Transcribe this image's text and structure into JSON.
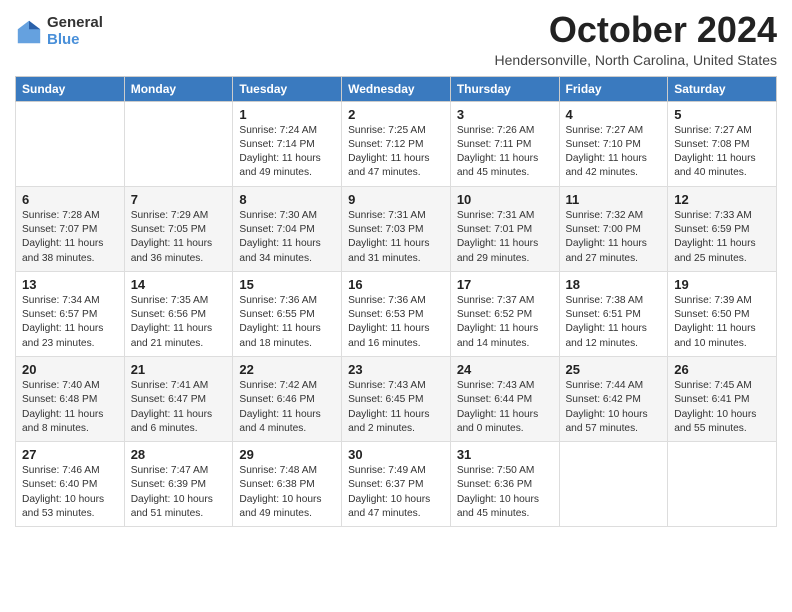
{
  "header": {
    "logo_general": "General",
    "logo_blue": "Blue",
    "month_title": "October 2024",
    "location": "Hendersonville, North Carolina, United States"
  },
  "days_of_week": [
    "Sunday",
    "Monday",
    "Tuesday",
    "Wednesday",
    "Thursday",
    "Friday",
    "Saturday"
  ],
  "weeks": [
    [
      {
        "day": "",
        "sunrise": "",
        "sunset": "",
        "daylight": ""
      },
      {
        "day": "",
        "sunrise": "",
        "sunset": "",
        "daylight": ""
      },
      {
        "day": "1",
        "sunrise": "Sunrise: 7:24 AM",
        "sunset": "Sunset: 7:14 PM",
        "daylight": "Daylight: 11 hours and 49 minutes."
      },
      {
        "day": "2",
        "sunrise": "Sunrise: 7:25 AM",
        "sunset": "Sunset: 7:12 PM",
        "daylight": "Daylight: 11 hours and 47 minutes."
      },
      {
        "day": "3",
        "sunrise": "Sunrise: 7:26 AM",
        "sunset": "Sunset: 7:11 PM",
        "daylight": "Daylight: 11 hours and 45 minutes."
      },
      {
        "day": "4",
        "sunrise": "Sunrise: 7:27 AM",
        "sunset": "Sunset: 7:10 PM",
        "daylight": "Daylight: 11 hours and 42 minutes."
      },
      {
        "day": "5",
        "sunrise": "Sunrise: 7:27 AM",
        "sunset": "Sunset: 7:08 PM",
        "daylight": "Daylight: 11 hours and 40 minutes."
      }
    ],
    [
      {
        "day": "6",
        "sunrise": "Sunrise: 7:28 AM",
        "sunset": "Sunset: 7:07 PM",
        "daylight": "Daylight: 11 hours and 38 minutes."
      },
      {
        "day": "7",
        "sunrise": "Sunrise: 7:29 AM",
        "sunset": "Sunset: 7:05 PM",
        "daylight": "Daylight: 11 hours and 36 minutes."
      },
      {
        "day": "8",
        "sunrise": "Sunrise: 7:30 AM",
        "sunset": "Sunset: 7:04 PM",
        "daylight": "Daylight: 11 hours and 34 minutes."
      },
      {
        "day": "9",
        "sunrise": "Sunrise: 7:31 AM",
        "sunset": "Sunset: 7:03 PM",
        "daylight": "Daylight: 11 hours and 31 minutes."
      },
      {
        "day": "10",
        "sunrise": "Sunrise: 7:31 AM",
        "sunset": "Sunset: 7:01 PM",
        "daylight": "Daylight: 11 hours and 29 minutes."
      },
      {
        "day": "11",
        "sunrise": "Sunrise: 7:32 AM",
        "sunset": "Sunset: 7:00 PM",
        "daylight": "Daylight: 11 hours and 27 minutes."
      },
      {
        "day": "12",
        "sunrise": "Sunrise: 7:33 AM",
        "sunset": "Sunset: 6:59 PM",
        "daylight": "Daylight: 11 hours and 25 minutes."
      }
    ],
    [
      {
        "day": "13",
        "sunrise": "Sunrise: 7:34 AM",
        "sunset": "Sunset: 6:57 PM",
        "daylight": "Daylight: 11 hours and 23 minutes."
      },
      {
        "day": "14",
        "sunrise": "Sunrise: 7:35 AM",
        "sunset": "Sunset: 6:56 PM",
        "daylight": "Daylight: 11 hours and 21 minutes."
      },
      {
        "day": "15",
        "sunrise": "Sunrise: 7:36 AM",
        "sunset": "Sunset: 6:55 PM",
        "daylight": "Daylight: 11 hours and 18 minutes."
      },
      {
        "day": "16",
        "sunrise": "Sunrise: 7:36 AM",
        "sunset": "Sunset: 6:53 PM",
        "daylight": "Daylight: 11 hours and 16 minutes."
      },
      {
        "day": "17",
        "sunrise": "Sunrise: 7:37 AM",
        "sunset": "Sunset: 6:52 PM",
        "daylight": "Daylight: 11 hours and 14 minutes."
      },
      {
        "day": "18",
        "sunrise": "Sunrise: 7:38 AM",
        "sunset": "Sunset: 6:51 PM",
        "daylight": "Daylight: 11 hours and 12 minutes."
      },
      {
        "day": "19",
        "sunrise": "Sunrise: 7:39 AM",
        "sunset": "Sunset: 6:50 PM",
        "daylight": "Daylight: 11 hours and 10 minutes."
      }
    ],
    [
      {
        "day": "20",
        "sunrise": "Sunrise: 7:40 AM",
        "sunset": "Sunset: 6:48 PM",
        "daylight": "Daylight: 11 hours and 8 minutes."
      },
      {
        "day": "21",
        "sunrise": "Sunrise: 7:41 AM",
        "sunset": "Sunset: 6:47 PM",
        "daylight": "Daylight: 11 hours and 6 minutes."
      },
      {
        "day": "22",
        "sunrise": "Sunrise: 7:42 AM",
        "sunset": "Sunset: 6:46 PM",
        "daylight": "Daylight: 11 hours and 4 minutes."
      },
      {
        "day": "23",
        "sunrise": "Sunrise: 7:43 AM",
        "sunset": "Sunset: 6:45 PM",
        "daylight": "Daylight: 11 hours and 2 minutes."
      },
      {
        "day": "24",
        "sunrise": "Sunrise: 7:43 AM",
        "sunset": "Sunset: 6:44 PM",
        "daylight": "Daylight: 11 hours and 0 minutes."
      },
      {
        "day": "25",
        "sunrise": "Sunrise: 7:44 AM",
        "sunset": "Sunset: 6:42 PM",
        "daylight": "Daylight: 10 hours and 57 minutes."
      },
      {
        "day": "26",
        "sunrise": "Sunrise: 7:45 AM",
        "sunset": "Sunset: 6:41 PM",
        "daylight": "Daylight: 10 hours and 55 minutes."
      }
    ],
    [
      {
        "day": "27",
        "sunrise": "Sunrise: 7:46 AM",
        "sunset": "Sunset: 6:40 PM",
        "daylight": "Daylight: 10 hours and 53 minutes."
      },
      {
        "day": "28",
        "sunrise": "Sunrise: 7:47 AM",
        "sunset": "Sunset: 6:39 PM",
        "daylight": "Daylight: 10 hours and 51 minutes."
      },
      {
        "day": "29",
        "sunrise": "Sunrise: 7:48 AM",
        "sunset": "Sunset: 6:38 PM",
        "daylight": "Daylight: 10 hours and 49 minutes."
      },
      {
        "day": "30",
        "sunrise": "Sunrise: 7:49 AM",
        "sunset": "Sunset: 6:37 PM",
        "daylight": "Daylight: 10 hours and 47 minutes."
      },
      {
        "day": "31",
        "sunrise": "Sunrise: 7:50 AM",
        "sunset": "Sunset: 6:36 PM",
        "daylight": "Daylight: 10 hours and 45 minutes."
      },
      {
        "day": "",
        "sunrise": "",
        "sunset": "",
        "daylight": ""
      },
      {
        "day": "",
        "sunrise": "",
        "sunset": "",
        "daylight": ""
      }
    ]
  ]
}
